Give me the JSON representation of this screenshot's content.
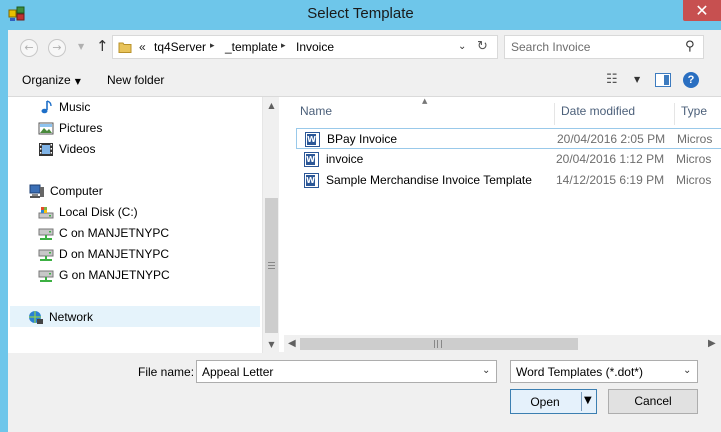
{
  "window": {
    "title": "Select Template",
    "close_glyph": "✕"
  },
  "nav": {
    "back_glyph": "←",
    "forward_glyph": "→",
    "up_glyph": "↑"
  },
  "address": {
    "prefix": "«",
    "crumbs": [
      "tq4Server",
      "_template",
      "Invoice"
    ],
    "separator": "▸",
    "dropdown_glyph": "⌄",
    "refresh_glyph": "↻"
  },
  "search": {
    "placeholder": "Search Invoice",
    "icon_glyph": "⚲"
  },
  "toolbar": {
    "organize_label": "Organize",
    "new_folder_label": "New folder",
    "views_glyph": "☷",
    "help_glyph": "?"
  },
  "nav_pane": {
    "items": [
      {
        "label": "Music",
        "icon": "music-icon"
      },
      {
        "label": "Pictures",
        "icon": "pictures-icon"
      },
      {
        "label": "Videos",
        "icon": "videos-icon"
      },
      {
        "label": "Computer",
        "icon": "computer-icon"
      },
      {
        "label": "Local Disk (C:)",
        "icon": "local-disk-icon"
      },
      {
        "label": "C on MANJETNYPC",
        "icon": "network-drive-icon"
      },
      {
        "label": "D on MANJETNYPC",
        "icon": "network-drive-icon"
      },
      {
        "label": "G on MANJETNYPC",
        "icon": "network-drive-icon"
      },
      {
        "label": "Network",
        "icon": "network-icon",
        "selected": true
      }
    ]
  },
  "file_list": {
    "columns": [
      "Name",
      "Date modified",
      "Type"
    ],
    "sort_column": "Name",
    "rows": [
      {
        "name": "BPay Invoice",
        "date": "20/04/2016 2:05 PM",
        "type": "Micros",
        "icon": "word-document-icon",
        "focused": true
      },
      {
        "name": "invoice",
        "date": "20/04/2016 1:12 PM",
        "type": "Micros",
        "icon": "word-document-icon"
      },
      {
        "name": "Sample Merchandise Invoice Template",
        "date": "14/12/2015 6:19 PM",
        "type": "Micros",
        "icon": "word-document-icon"
      }
    ]
  },
  "footer": {
    "file_name_label": "File name:",
    "file_name_value": "Appeal Letter",
    "file_type_value": "Word Templates (*.dot*)",
    "open_label": "Open",
    "cancel_label": "Cancel"
  },
  "colors": {
    "title_bar": "#6ec6ea",
    "close_button": "#c75050",
    "selection": "#e5f3fb",
    "word_icon": "#2b5797"
  }
}
